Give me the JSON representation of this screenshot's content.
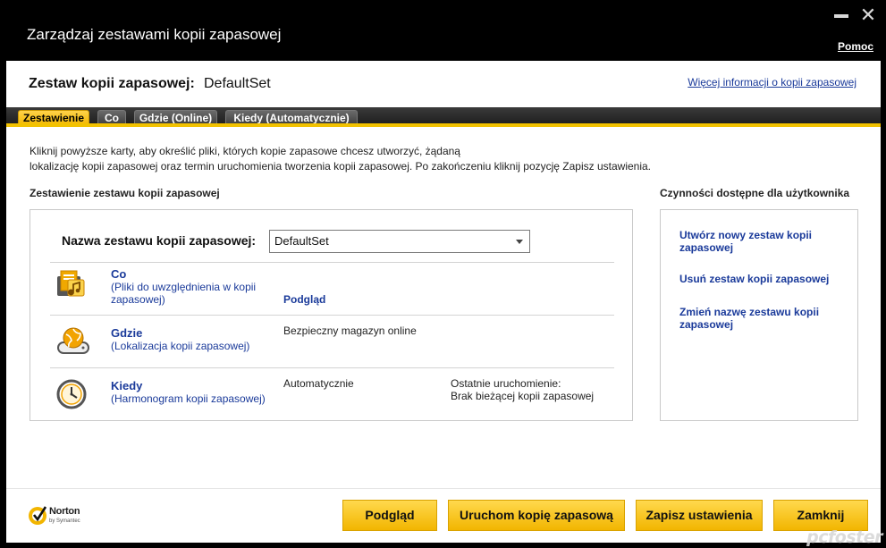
{
  "window": {
    "title": "Zarządzaj zestawami kopii zapasowej",
    "help": "Pomoc"
  },
  "header": {
    "set_label": "Zestaw kopii zapasowej:",
    "set_value": "DefaultSet",
    "more_info": "Więcej informacji o kopii zapasowej"
  },
  "tabs": [
    {
      "label": "Zestawienie",
      "active": true
    },
    {
      "label": "Co",
      "active": false
    },
    {
      "label": "Gdzie (Online)",
      "active": false
    },
    {
      "label": "Kiedy (Automatycznie)",
      "active": false
    }
  ],
  "intro": {
    "line1": "Kliknij powyższe karty, aby określić pliki, których kopie zapasowe chcesz utworzyć, żądaną",
    "line2": "lokalizację kopii zapasowej oraz termin uruchomienia tworzenia kopii zapasowej. Po zakończeniu kliknij pozycję Zapisz ustawienia."
  },
  "summary": {
    "title": "Zestawienie zestawu kopii zapasowej",
    "name_label": "Nazwa zestawu kopii zapasowej:",
    "name_value": "DefaultSet",
    "rows": [
      {
        "icon": "files-music-icon",
        "title": "Co",
        "subtitle": "(Pliki do uwzględnienia w kopii zapasowej)",
        "middle": "Podgląd",
        "right1": "",
        "right2": ""
      },
      {
        "icon": "online-storage-icon",
        "title": "Gdzie",
        "subtitle": "(Lokalizacja kopii zapasowej)",
        "middle": "Bezpieczny magazyn online",
        "right1": "",
        "right2": ""
      },
      {
        "icon": "clock-icon",
        "title": "Kiedy",
        "subtitle": "(Harmonogram kopii zapasowej)",
        "middle": "Automatycznie",
        "right1": "Ostatnie uruchomienie:",
        "right2": "Brak bieżącej kopii zapasowej"
      }
    ]
  },
  "actions": {
    "title": "Czynności dostępne dla użytkownika",
    "items": [
      "Utwórz nowy zestaw kopii zapasowej",
      "Usuń zestaw kopii zapasowej",
      "Zmień nazwę zestawu kopii zapasowej"
    ]
  },
  "footer": {
    "brand": "Norton",
    "brand_sub": "by Symantec",
    "buttons": [
      "Podgląd",
      "Uruchom kopię zapasową",
      "Zapisz ustawienia",
      "Zamknij"
    ]
  },
  "watermark": "pcfoster",
  "colors": {
    "accent": "#f2b700",
    "link": "#1a3a9a",
    "titlebar": "#000000"
  }
}
